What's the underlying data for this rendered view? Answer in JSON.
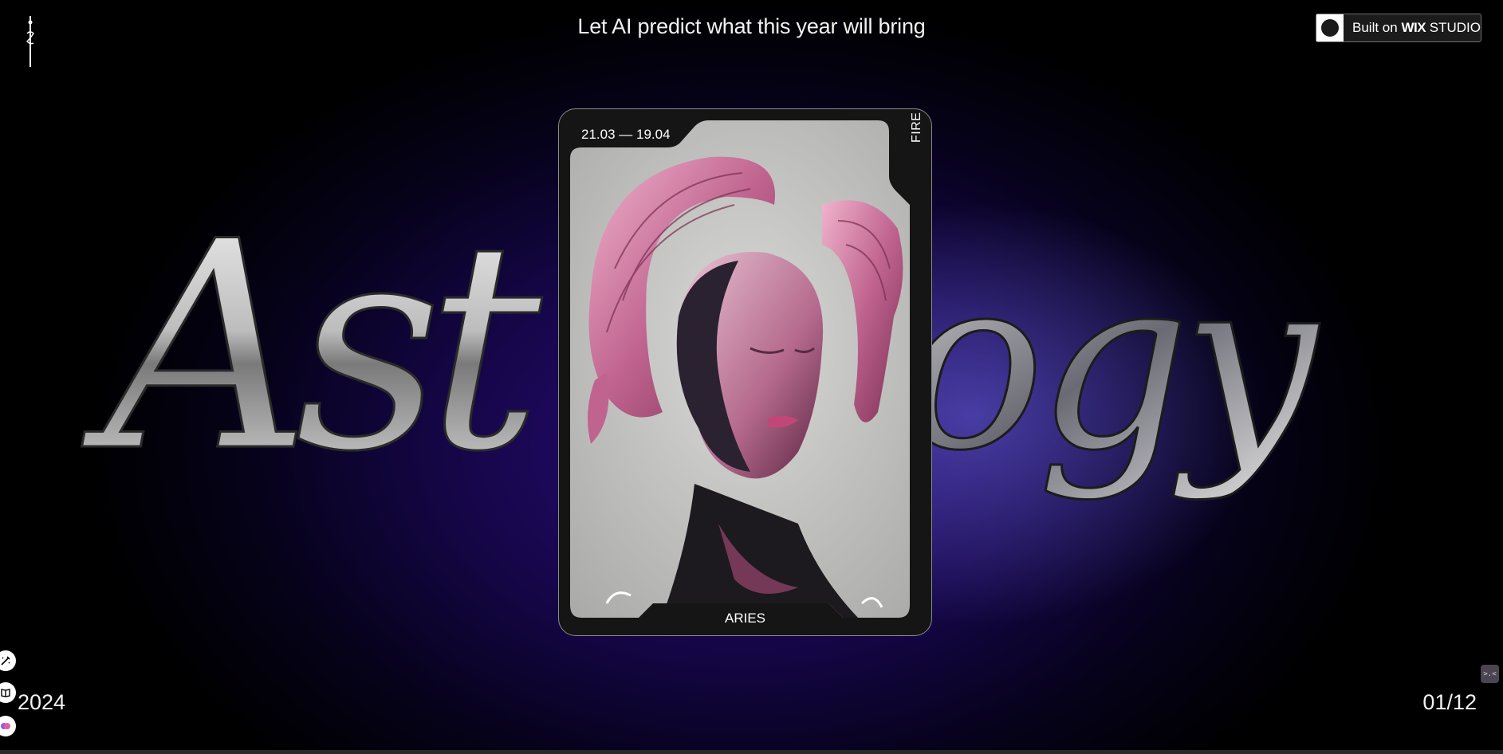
{
  "header": {
    "headline": "Let AI predict what this year will bring",
    "badge": {
      "prefix": "Built on ",
      "brand": "WIX",
      "suffix": " STUDIO"
    }
  },
  "background_word": {
    "left_part": "Ast",
    "right_part": "ogy"
  },
  "card": {
    "date_range": "21.03 — 19.04",
    "element": "FIRE",
    "sign": "ARIES"
  },
  "footer": {
    "year": "2024",
    "counter": "01/12"
  },
  "icons": {
    "logo": "figure-logo-icon",
    "side_buttons": [
      "wand-icon",
      "book-icon",
      "brain-icon"
    ],
    "corner": "sleeping-face-icon"
  },
  "colors": {
    "background": "#000000",
    "glow": "#2a0c7a",
    "card": "#151515",
    "accent_pink": "#c0648f"
  }
}
